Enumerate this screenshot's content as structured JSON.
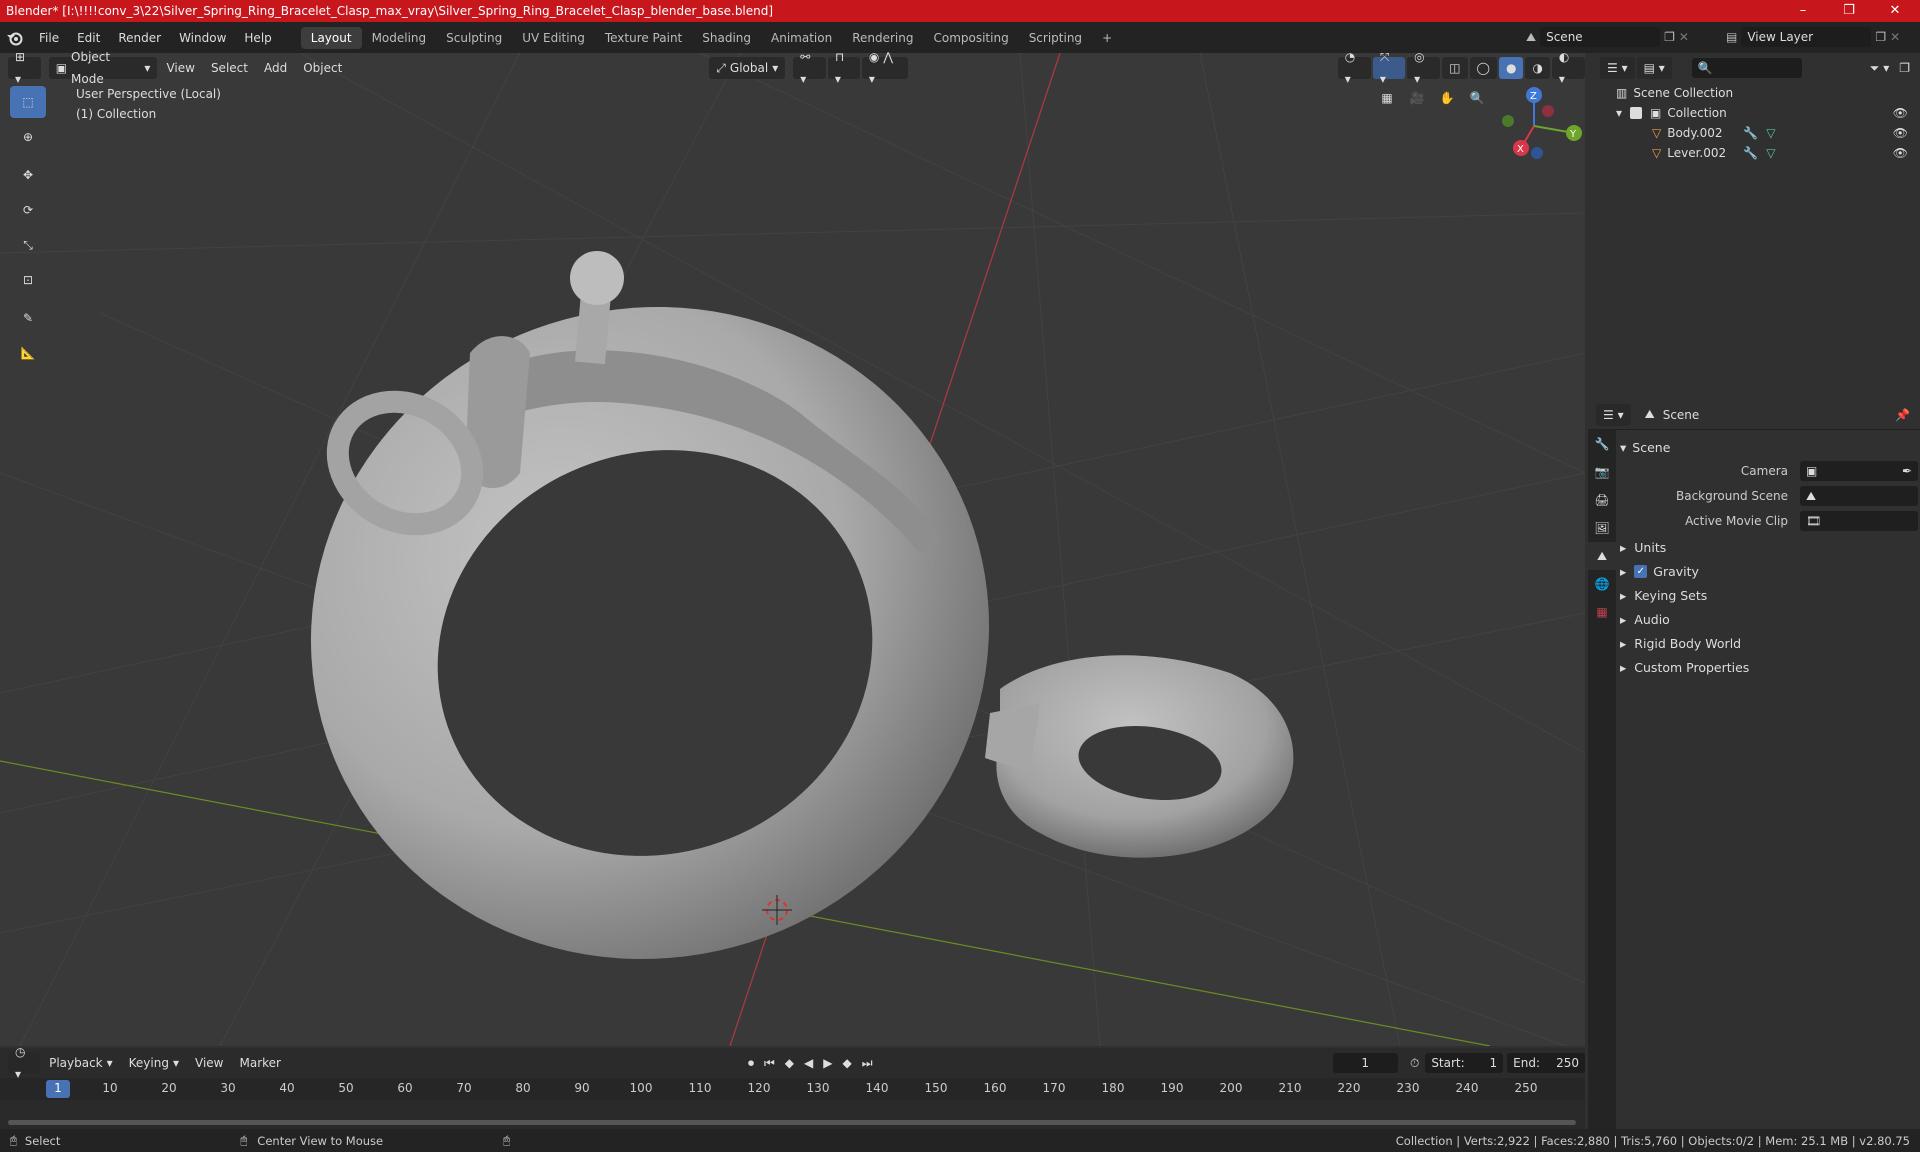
{
  "window": {
    "title": "Blender* [I:\\!!!!conv_3\\22\\Silver_Spring_Ring_Bracelet_Clasp_max_vray\\Silver_Spring_Ring_Bracelet_Clasp_blender_base.blend]",
    "minimize": "–",
    "maximize": "❐",
    "close": "✕"
  },
  "menu": [
    "File",
    "Edit",
    "Render",
    "Window",
    "Help"
  ],
  "workspaces": [
    "Layout",
    "Modeling",
    "Sculpting",
    "UV Editing",
    "Texture Paint",
    "Shading",
    "Animation",
    "Rendering",
    "Compositing",
    "Scripting"
  ],
  "scene_field": "Scene",
  "view_layer_field": "View Layer",
  "viewport": {
    "mode": "Object Mode",
    "menus": [
      "View",
      "Select",
      "Add",
      "Object"
    ],
    "orientation": "Global",
    "info_line1": "User Perspective (Local)",
    "info_line2": "(1) Collection",
    "axis_z": "Z",
    "axis_y": "Y",
    "axis_x": "X"
  },
  "outliner": {
    "root": "Scene Collection",
    "collection": "Collection",
    "objects": [
      "Body.002",
      "Lever.002"
    ]
  },
  "properties": {
    "header": "Scene",
    "panel": "Scene",
    "camera_label": "Camera",
    "bg_scene_label": "Background Scene",
    "movie_clip_label": "Active Movie Clip",
    "sections": [
      "Units",
      "Gravity",
      "Keying Sets",
      "Audio",
      "Rigid Body World",
      "Custom Properties"
    ]
  },
  "timeline": {
    "menus": [
      "Playback",
      "Keying",
      "View",
      "Marker"
    ],
    "current_frame": "1",
    "start_label": "Start:",
    "start_value": "1",
    "end_label": "End:",
    "end_value": "250",
    "ticks": [
      "1",
      "10",
      "20",
      "30",
      "40",
      "50",
      "60",
      "70",
      "80",
      "90",
      "100",
      "110",
      "120",
      "130",
      "140",
      "150",
      "160",
      "170",
      "180",
      "190",
      "200",
      "210",
      "220",
      "230",
      "240",
      "250"
    ]
  },
  "status": {
    "select": "Select",
    "center": "Center View to Mouse",
    "stats": "Collection | Verts:2,922 | Faces:2,880 | Tris:5,760 | Objects:0/2 | Mem: 25.1 MB | v2.80.75"
  }
}
